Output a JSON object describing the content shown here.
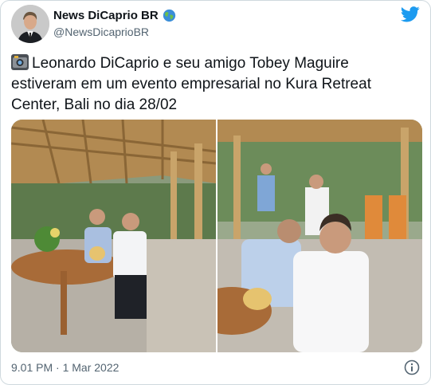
{
  "tweet": {
    "author_name": "News DiCaprio BR",
    "author_handle": "@NewsDicaprioBR",
    "text": "Leonardo DiCaprio e seu amigo Tobey Maguire estiveram em um evento empresarial no Kura Retreat Center, Bali no dia 28/02",
    "timestamp": "9.01 PM · 1 Mar 2022"
  },
  "icons": {
    "globe": "globe-icon",
    "twitter": "twitter-bird-icon",
    "camera": "camera-icon",
    "info": "info-icon"
  },
  "colors": {
    "twitter_blue": "#1d9bf0",
    "secondary_text": "#536471"
  }
}
